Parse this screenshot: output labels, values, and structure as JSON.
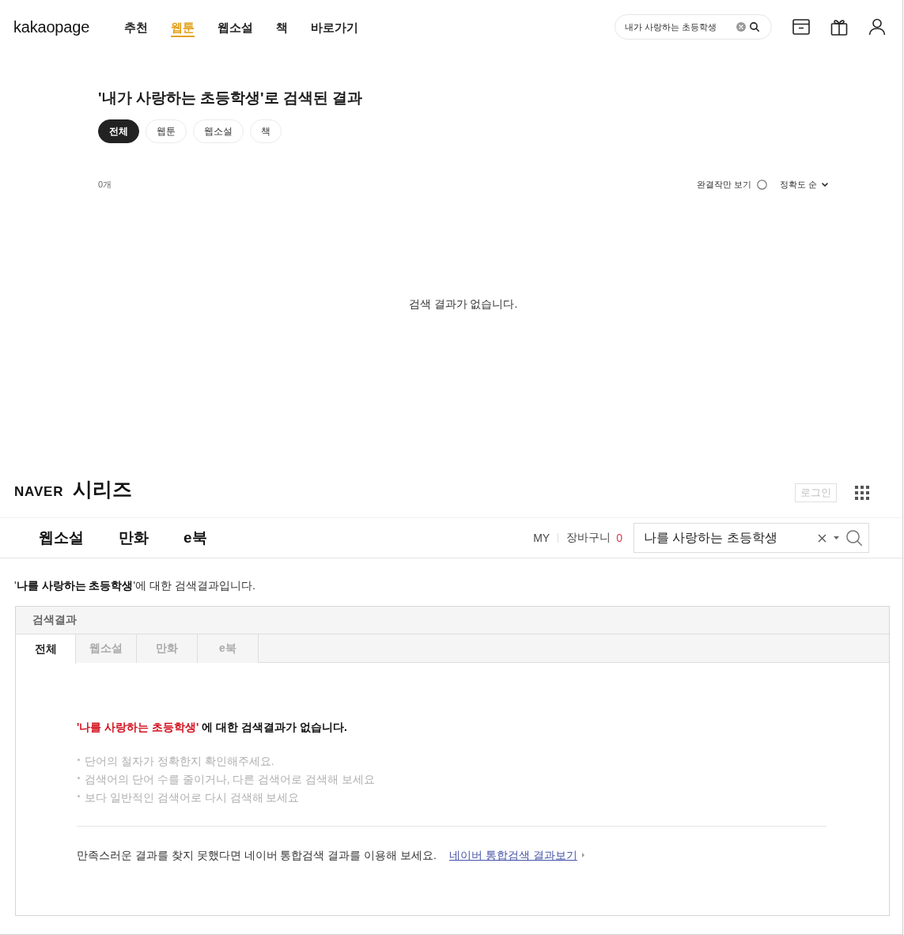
{
  "kakaopage": {
    "logo": "kakaopage",
    "nav": [
      {
        "label": "추천",
        "selected": false
      },
      {
        "label": "웹툰",
        "selected": true
      },
      {
        "label": "웹소설",
        "selected": false
      },
      {
        "label": "책",
        "selected": false
      },
      {
        "label": "바로가기",
        "selected": false
      }
    ],
    "search": {
      "value": "내가 사랑하는 초등학생"
    },
    "title": "'내가 사랑하는 초등학생'로 검색된 결과",
    "filters": [
      {
        "label": "전체",
        "selected": true
      },
      {
        "label": "웹툰",
        "selected": false
      },
      {
        "label": "웹소설",
        "selected": false
      },
      {
        "label": "책",
        "selected": false
      }
    ],
    "count": "0개",
    "completed_only": {
      "label": "완결작만 보기",
      "checked": false
    },
    "sort": {
      "label": "정확도 순"
    },
    "empty_message": "검색 결과가 없습니다."
  },
  "naver_series": {
    "logo": {
      "brand": "NAVER",
      "service": "시리즈"
    },
    "login_button": "로그인",
    "nav": [
      "웹소설",
      "만화",
      "e북"
    ],
    "my_link": "MY",
    "cart": {
      "label": "장바구니",
      "count": "0"
    },
    "search": {
      "value": "나를 사랑하는 초등학생"
    },
    "result_intro": "'**나를 사랑하는 초등학생**'에 대한 검색결과입니다.",
    "panel": {
      "title": "검색결과",
      "tabs": [
        {
          "label": "전체",
          "selected": true
        },
        {
          "label": "웹소설",
          "selected": false
        },
        {
          "label": "만화",
          "selected": false
        },
        {
          "label": "e북",
          "selected": false
        }
      ],
      "no_result": {
        "term": "'나를 사랑하는 초등학생'",
        "text": " 에 대한 검색결과가 없습니다."
      },
      "tips": [
        "단어의 철자가 정확한지 확인해주세요.",
        "검색어의 단어 수를 줄이거나, 다른 검색어로 검색해 보세요",
        "보다 일반적인 검색어로 다시 검색해 보세요"
      ],
      "suggestion": {
        "text": "만족스러운 결과를 찾지 못했다면 네이버 통합검색 결과를 이용해 보세요.",
        "link": "네이버 통합검색 결과보기"
      }
    }
  }
}
